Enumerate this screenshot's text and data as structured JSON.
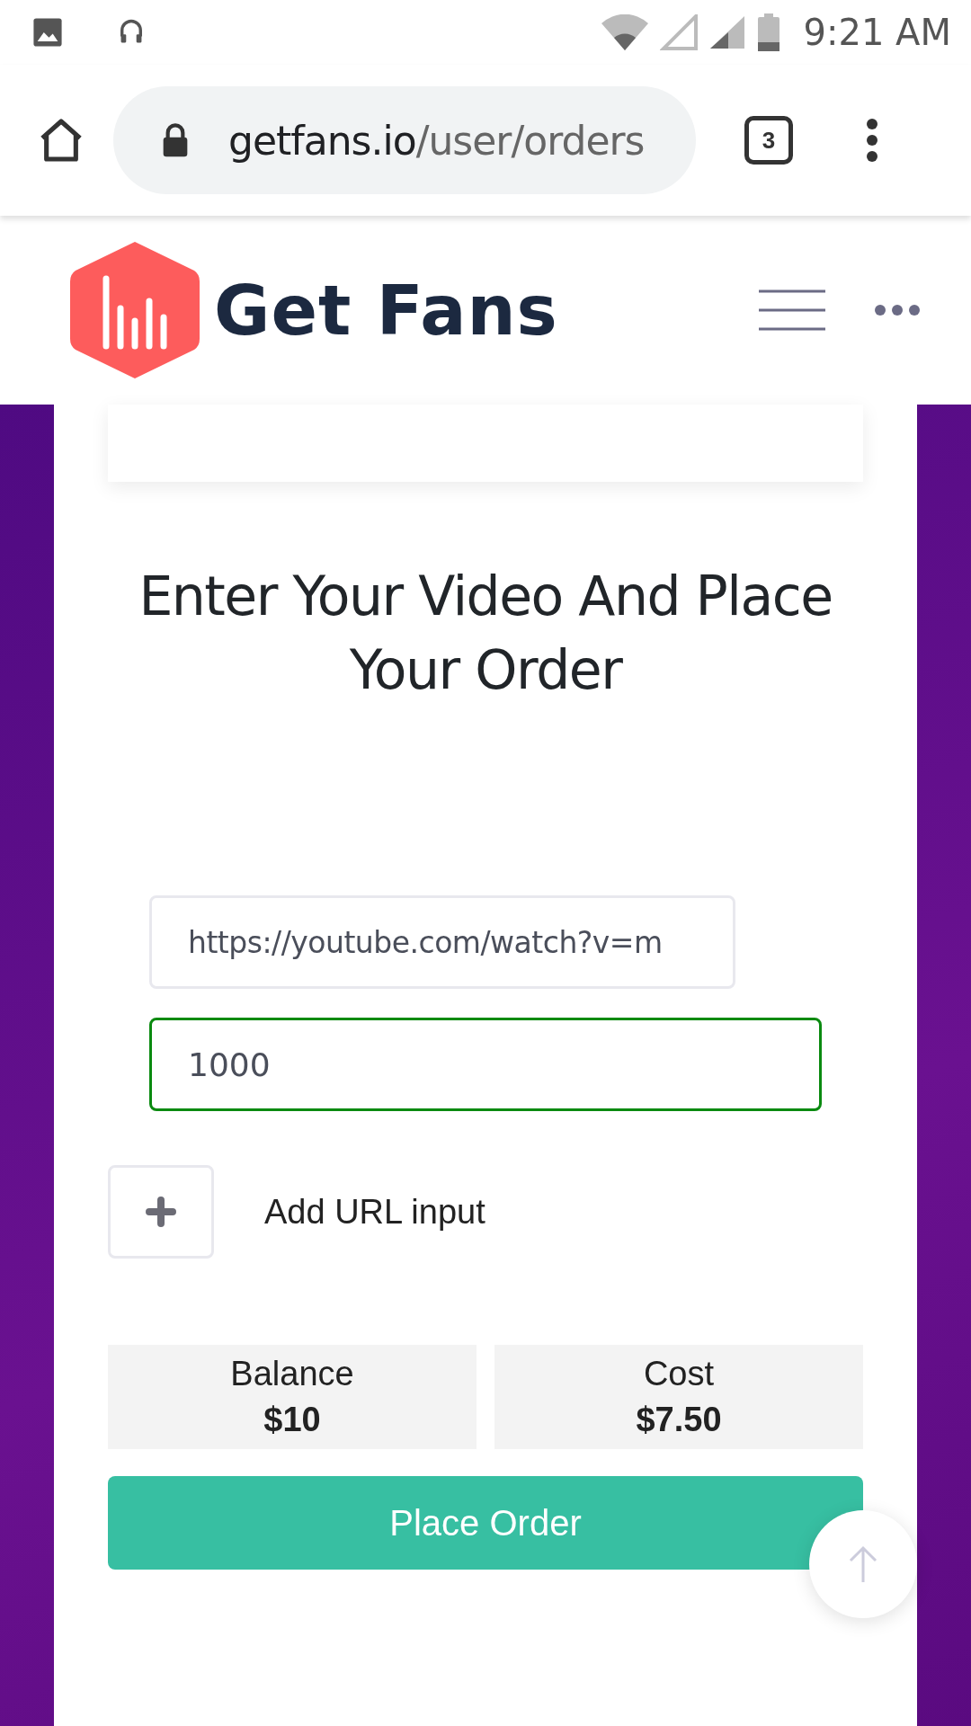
{
  "status_bar": {
    "time": "9:21 AM"
  },
  "browser": {
    "url_host": "getfans.io",
    "url_path": "/user/orders",
    "tab_count": "3"
  },
  "site_header": {
    "brand": "Get Fans"
  },
  "heading": "Enter Your Video And Place Your Order",
  "fields": [
    {
      "kind": "url",
      "value": "https://youtube.com/watch?v=m",
      "valid": false
    },
    {
      "kind": "quantity",
      "value": "1000",
      "valid": true
    }
  ],
  "add_url": {
    "label": "Add URL input"
  },
  "summary": [
    {
      "label": "Balance",
      "value": "$10"
    },
    {
      "label": "Cost",
      "value": "$7.50"
    }
  ],
  "submit": {
    "label": "Place Order"
  }
}
